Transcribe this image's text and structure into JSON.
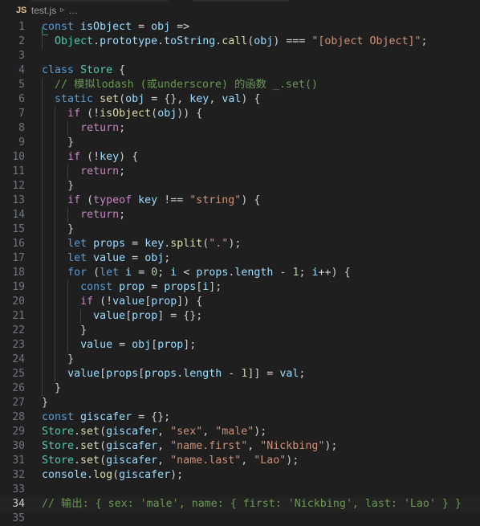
{
  "window": {
    "background": "#1f1f1f",
    "editor_background": "#1f1f1f",
    "active_line_background": "#232323"
  },
  "breadcrumb": {
    "file_icon_label": "JS",
    "file_name": "test.js",
    "separator": "▹",
    "overflow": "…"
  },
  "editor": {
    "language": "javascript",
    "active_line": 34,
    "total_lines_visible": 35,
    "lines": [
      {
        "n": 1,
        "text": "const isObject = obj =>"
      },
      {
        "n": 2,
        "text": "  Object.prototype.toString.call(obj) === \"[object Object]\";"
      },
      {
        "n": 3,
        "text": ""
      },
      {
        "n": 4,
        "text": "class Store {"
      },
      {
        "n": 5,
        "text": "  // 模拟lodash (或underscore) 的函数 _.set()"
      },
      {
        "n": 6,
        "text": "  static set(obj = {}, key, val) {"
      },
      {
        "n": 7,
        "text": "    if (!isObject(obj)) {"
      },
      {
        "n": 8,
        "text": "      return;"
      },
      {
        "n": 9,
        "text": "    }"
      },
      {
        "n": 10,
        "text": "    if (!key) {"
      },
      {
        "n": 11,
        "text": "      return;"
      },
      {
        "n": 12,
        "text": "    }"
      },
      {
        "n": 13,
        "text": "    if (typeof key !== \"string\") {"
      },
      {
        "n": 14,
        "text": "      return;"
      },
      {
        "n": 15,
        "text": "    }"
      },
      {
        "n": 16,
        "text": "    let props = key.split(\".\");"
      },
      {
        "n": 17,
        "text": "    let value = obj;"
      },
      {
        "n": 18,
        "text": "    for (let i = 0; i < props.length - 1; i++) {"
      },
      {
        "n": 19,
        "text": "      const prop = props[i];"
      },
      {
        "n": 20,
        "text": "      if (!value[prop]) {"
      },
      {
        "n": 21,
        "text": "        value[prop] = {};"
      },
      {
        "n": 22,
        "text": "      }"
      },
      {
        "n": 23,
        "text": "      value = obj[prop];"
      },
      {
        "n": 24,
        "text": "    }"
      },
      {
        "n": 25,
        "text": "    value[props[props.length - 1]] = val;"
      },
      {
        "n": 26,
        "text": "  }"
      },
      {
        "n": 27,
        "text": "}"
      },
      {
        "n": 28,
        "text": "const giscafer = {};"
      },
      {
        "n": 29,
        "text": "Store.set(giscafer, \"sex\", \"male\");"
      },
      {
        "n": 30,
        "text": "Store.set(giscafer, \"name.first\", \"Nickbing\");"
      },
      {
        "n": 31,
        "text": "Store.set(giscafer, \"name.last\", \"Lao\");"
      },
      {
        "n": 32,
        "text": "console.log(giscafer);"
      },
      {
        "n": 33,
        "text": ""
      },
      {
        "n": 34,
        "text": "// 输出: { sex: 'male', name: { first: 'Nickbing', last: 'Lao' } }"
      },
      {
        "n": 35,
        "text": ""
      }
    ]
  },
  "theme_colors": {
    "keyword": "#569cd6",
    "control": "#c586c0",
    "function": "#dcdcaa",
    "variable": "#9cdcfe",
    "type": "#4ec9b0",
    "string": "#ce9178",
    "number": "#b5cea8",
    "comment": "#6a9955",
    "punctuation": "#cccccc",
    "line_number": "#6e7681",
    "active_line_number": "#cccccc",
    "indent_guide": "#404040",
    "bracket_match": "#4a8f6f",
    "js_badge": "#e2c08d"
  }
}
